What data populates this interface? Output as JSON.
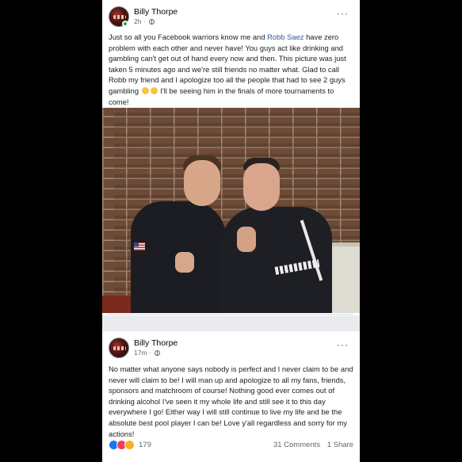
{
  "posts": [
    {
      "author": "Billy Thorpe",
      "time": "2h",
      "text_before_link": "Just so all you Facebook warriors know me and ",
      "link_text": "Robb Saez",
      "text_after_link": " have zero problem with each other and never have! You guys act like drinking and gambling  can't get out of hand every now and then. This picture was just taken 5 minutes ago and we're still friends no matter what. Glad to call Robb my friend and I apologize too all the people that had to see 2 guys gambling ",
      "text_end": " I'll be seeing him in the finals of more tournaments to come!",
      "emojis": [
        "grinning-sweat-emoji",
        "grinning-sweat-emoji"
      ]
    },
    {
      "author": "Billy Thorpe",
      "time": "17m",
      "text": "No matter what anyone says nobody is perfect and I never claim to be and never will claim to be! I will man up and apologize to all my fans, friends, sponsors and matchroom of course! Nothing good ever comes out of drinking alcohol I've seen it my whole life and still see it to this day everywhere I go!   Either way I will still continue to live my life and be the absolute best pool player I can be! Love y'all regardless and sorry for my actions!",
      "reaction_count": "179",
      "comments": "31 Comments",
      "shares": "1 Share"
    }
  ],
  "icons": {
    "more": "more-options-icon",
    "privacy": "globe-icon",
    "reactions": [
      "like-reaction-icon",
      "love-reaction-icon",
      "care-reaction-icon"
    ]
  },
  "colors": {
    "link": "#385898",
    "like": "#1877f2",
    "love": "#f33e58",
    "online": "#31a24c"
  }
}
